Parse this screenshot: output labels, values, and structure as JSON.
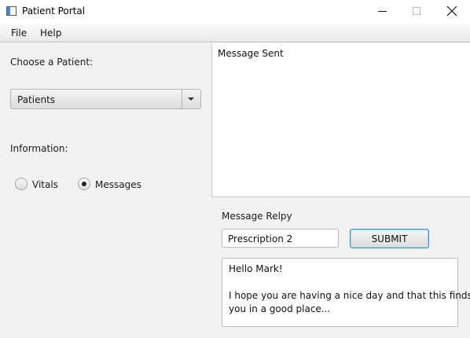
{
  "window": {
    "title": "Patient Portal"
  },
  "menu": {
    "file_label": "File",
    "help_label": "Help"
  },
  "patient_selector": {
    "label": "Choose a Patient:",
    "selected_value": "Patients"
  },
  "information": {
    "label": "Information:",
    "options": [
      {
        "label": "Vitals",
        "selected": false
      },
      {
        "label": "Messages",
        "selected": true
      }
    ]
  },
  "message_display": {
    "text": "Message Sent"
  },
  "reply": {
    "label": "Message Relpy",
    "subject_value": "Prescription 2",
    "submit_label": "SUBMIT",
    "body_lines": [
      "Hello Mark!",
      "I hope you are having a nice day and that this finds",
      "you in a good place..."
    ]
  },
  "icons": {
    "app": "app-window-icon",
    "minimize": "minimize-icon",
    "maximize": "maximize-icon",
    "close": "close-icon",
    "dropdown": "chevron-down-icon"
  },
  "colors": {
    "background": "#f2f2f2",
    "focus_border": "#3f8fd6",
    "panel_white": "#ffffff"
  }
}
